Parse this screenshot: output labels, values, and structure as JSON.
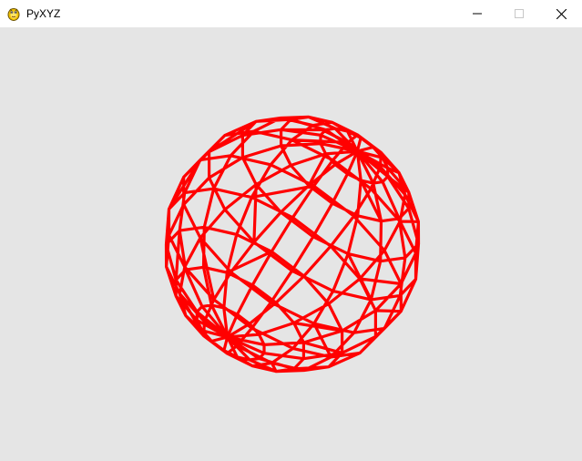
{
  "window": {
    "title": "PyXYZ",
    "app_icon": "pygame-snake-icon",
    "controls": {
      "minimize_icon": "minimize-icon",
      "maximize_icon": "maximize-icon",
      "close_icon": "close-icon"
    }
  },
  "scene": {
    "object": "wireframe-sphere",
    "wire_color": "#ff0000",
    "background_color": "#e5e5e5"
  }
}
